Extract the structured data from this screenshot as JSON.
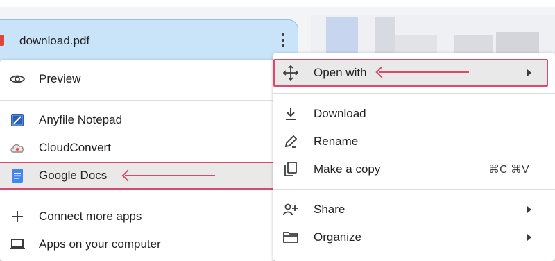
{
  "file": {
    "name": "download.pdf"
  },
  "left_menu": {
    "preview": "Preview",
    "apps": [
      "Anyfile Notepad",
      "CloudConvert",
      "Google Docs"
    ],
    "connect": "Connect more apps",
    "computer": "Apps on your computer"
  },
  "right_menu": {
    "open_with": "Open with",
    "download": "Download",
    "rename": "Rename",
    "make_copy": "Make a copy",
    "make_copy_shortcut": "⌘C ⌘V",
    "share": "Share",
    "organize": "Organize"
  },
  "colors": {
    "highlight": "#e0486a",
    "card": "#c9e3f9",
    "pdf": "#e2463a"
  },
  "icons": [
    "eye-icon",
    "notepad-icon",
    "cloud-icon",
    "docs-icon",
    "plus-icon",
    "laptop-icon",
    "move-icon",
    "download-icon",
    "rename-icon",
    "copy-icon",
    "share-icon",
    "folder-icon"
  ]
}
